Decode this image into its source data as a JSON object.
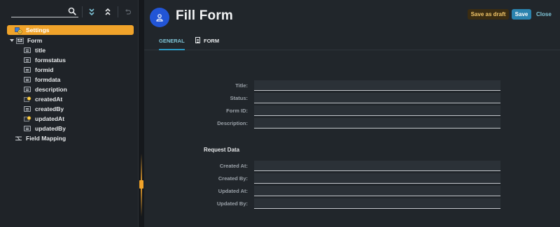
{
  "toolbar": {
    "search_placeholder": "",
    "icons": [
      "search-icon",
      "expand-all-icon",
      "collapse-all-icon",
      "undo-icon"
    ]
  },
  "tree": {
    "items": [
      {
        "label": "Settings",
        "icon": "settings-icon",
        "selected": true
      },
      {
        "label": "Form",
        "icon": "form-icon",
        "expanded": true
      },
      {
        "label": "title",
        "icon": "field-icon"
      },
      {
        "label": "formstatus",
        "icon": "field-icon"
      },
      {
        "label": "formid",
        "icon": "field-icon"
      },
      {
        "label": "formdata",
        "icon": "field-icon"
      },
      {
        "label": "description",
        "icon": "field-icon"
      },
      {
        "label": "createdAt",
        "icon": "key-field-icon"
      },
      {
        "label": "createdBy",
        "icon": "field-icon"
      },
      {
        "label": "updatedAt",
        "icon": "key-field-icon"
      },
      {
        "label": "updatedBy",
        "icon": "field-icon"
      },
      {
        "label": "Field Mapping",
        "icon": "field-mapping-icon"
      }
    ]
  },
  "header": {
    "title": "Fill Form",
    "avatar_icon": "user-icon",
    "save_draft_label": "Save as draft",
    "save_label": "Save",
    "close_label": "Close"
  },
  "tabs": [
    {
      "label": "GENERAL",
      "active": true
    },
    {
      "label": "FORM",
      "active": false,
      "icon": "document-icon"
    }
  ],
  "form": {
    "fields": [
      {
        "label": "Title:",
        "value": ""
      },
      {
        "label": "Status:",
        "value": ""
      },
      {
        "label": "Form ID:",
        "value": ""
      },
      {
        "label": "Description:",
        "value": ""
      }
    ],
    "request_section_title": "Request Data",
    "request_fields": [
      {
        "label": "Created At:",
        "value": ""
      },
      {
        "label": "Created By:",
        "value": ""
      },
      {
        "label": "Updated At:",
        "value": ""
      },
      {
        "label": "Updated By:",
        "value": ""
      }
    ]
  },
  "colors": {
    "accent": "#f0a32a",
    "primary": "#2b83ae",
    "tab_active": "#7fc5d8",
    "avatar": "#2255d6",
    "draft_text": "#f3c76a"
  }
}
